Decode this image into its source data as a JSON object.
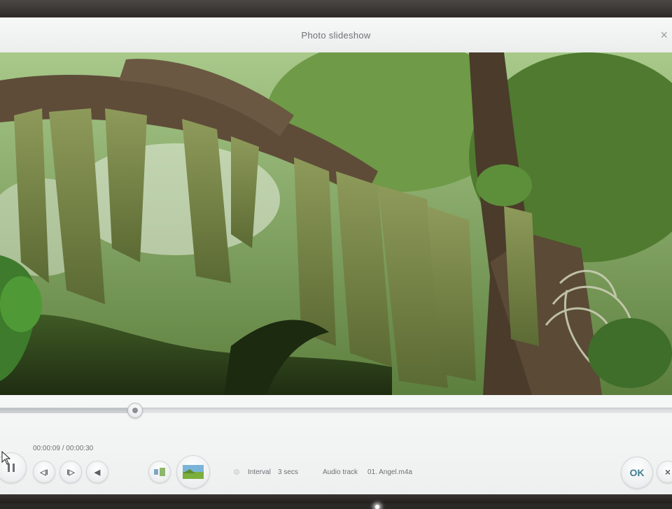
{
  "window": {
    "title": "Photo slideshow",
    "close_glyph": "×"
  },
  "slide": {
    "description_icon": "photo-preview"
  },
  "player": {
    "progress_fraction": 0.2,
    "elapsed": "00:00:09",
    "separator": " / ",
    "total": "00:00:30",
    "play_icon": "play-pause-icon",
    "prev_icon": "prev-icon",
    "next_icon": "next-icon",
    "volume_icon": "speaker-icon",
    "prev_glyph": "◁I",
    "next_glyph": "I▷",
    "volume_glyph": "◀"
  },
  "settings": {
    "interval_label": "Interval",
    "interval_value": "3 secs",
    "audio_label": "Audio track",
    "audio_value": "01. Angel.m4a"
  },
  "actions": {
    "ok_label": "OK",
    "cancel_glyph": "×"
  },
  "colors": {
    "accent": "#3f7f91",
    "window_bg": "#f3f4f5",
    "desktop_bg": "#2b2926"
  }
}
